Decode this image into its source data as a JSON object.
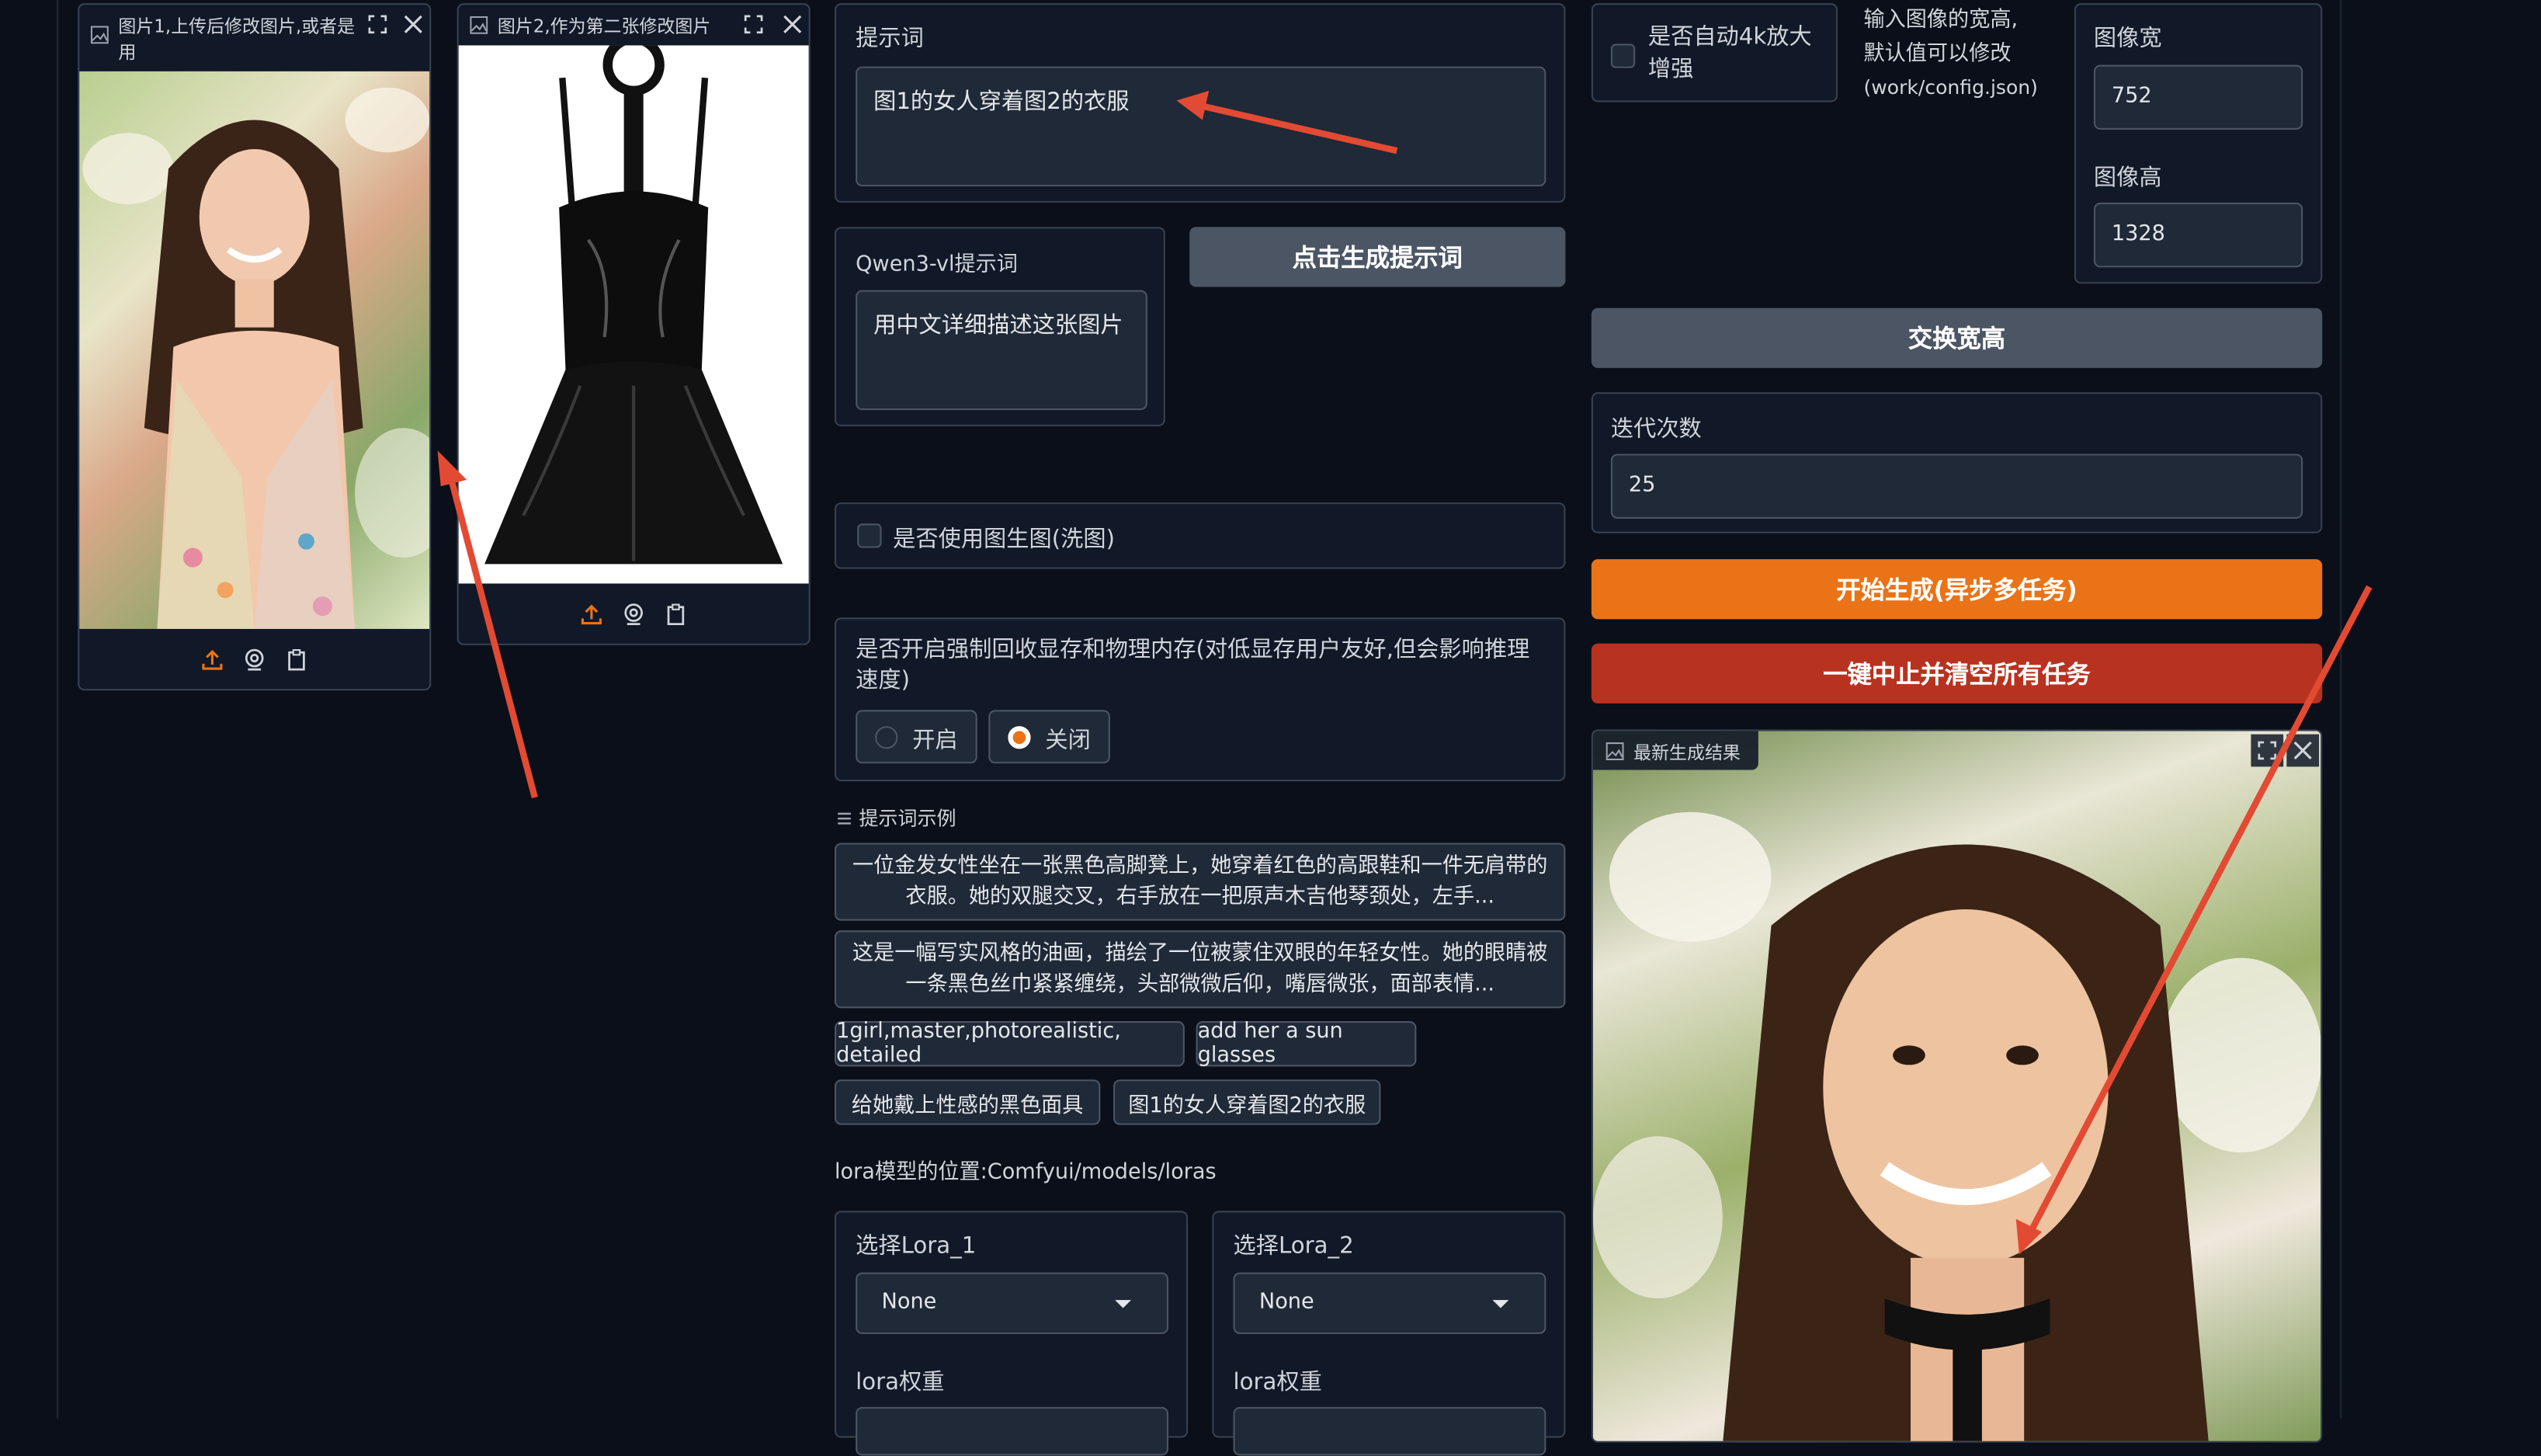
{
  "image1": {
    "label": "图片1,上传后修改图片,或者是",
    "label_line2": "用",
    "alt": "woman in floral dress smiling among flowers"
  },
  "image2": {
    "label": "图片2,作为第二张修改图片",
    "alt": "black patent leather halter dress"
  },
  "prompt": {
    "label": "提示词",
    "value": "图1的女人穿着图2的衣服"
  },
  "qwen": {
    "label": "Qwen3-vl提示词",
    "value": "用中文详细描述这张图片",
    "button": "点击生成提示词"
  },
  "img2img": {
    "label": "是否使用图生图(洗图)",
    "checked": false
  },
  "memory": {
    "label": "是否开启强制回收显存和物理内存(对低显存用户友好,但会影响推理速度)",
    "options": [
      "开启",
      "关闭"
    ],
    "selected": "关闭"
  },
  "examples": {
    "title": "提示词示例",
    "long": [
      "一位金发女性坐在一张黑色高脚凳上，她穿着红色的高跟鞋和一件无肩带的衣服。她的双腿交叉，右手放在一把原声木吉他琴颈处，左手...",
      "这是一幅写实风格的油画，描绘了一位被蒙住双眼的年轻女性。她的眼睛被一条黑色丝巾紧紧缠绕，头部微微后仰，嘴唇微张，面部表情..."
    ],
    "chips_row1": [
      "1girl,master,photorealistic, detailed",
      "add her a sun glasses"
    ],
    "chips_row2": [
      "给她戴上性感的黑色面具",
      "图1的女人穿着图2的衣服"
    ]
  },
  "lora": {
    "location": "lora模型的位置:Comfyui/models/loras",
    "lora1": {
      "label": "选择Lora_1",
      "value": "None",
      "weight_label": "lora权重"
    },
    "lora2": {
      "label": "选择Lora_2",
      "value": "None",
      "weight_label": "lora权重"
    }
  },
  "upscale": {
    "label": "是否自动4k放大增强",
    "checked": false
  },
  "size_note": {
    "line1": "输入图像的宽高,",
    "line2": "默认值可以修改",
    "line3": "(work/config.json)"
  },
  "width": {
    "label": "图像宽",
    "value": "752"
  },
  "height": {
    "label": "图像高",
    "value": "1328"
  },
  "swap_button": "交换宽高",
  "steps": {
    "label": "迭代次数",
    "value": "25"
  },
  "generate_button": "开始生成(异步多任务)",
  "stop_button": "一键中止并清空所有任务",
  "result": {
    "label": "最新生成结果",
    "alt": "generated woman wearing black harness choker"
  },
  "colors": {
    "accent": "#ea7317",
    "danger": "#b83220",
    "arrow": "#e34a33",
    "panel": "#1f2937",
    "bg": "#0b0f19"
  }
}
